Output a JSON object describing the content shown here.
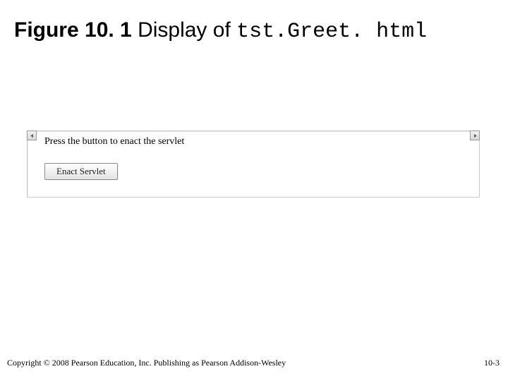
{
  "heading": {
    "figure_label": "Figure 10. 1",
    "text_middle": "  Display of ",
    "filename": "tst.Greet. html"
  },
  "browser": {
    "instruction": "Press the button to enact the servlet",
    "button_label": "Enact Servlet"
  },
  "footer": {
    "copyright": "Copyright © 2008 Pearson Education, Inc. Publishing as Pearson Addison-Wesley",
    "page_number": "10-3"
  }
}
